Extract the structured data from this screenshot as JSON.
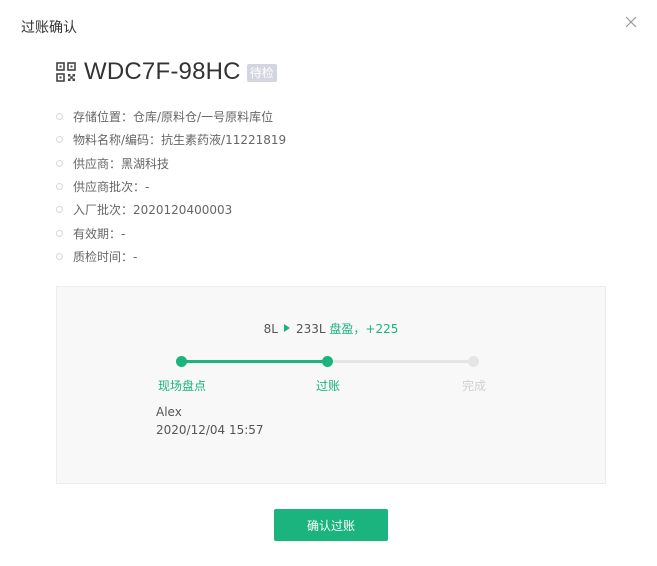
{
  "modal": {
    "title": "过账确认",
    "close_icon": "close-icon"
  },
  "material": {
    "qr_icon": "qr-code-icon",
    "code": "WDC7F-98HC",
    "status": "待检"
  },
  "details": [
    "存储位置：仓库/原料仓/一号原料库位",
    "物料名称/编码：抗生素药液/11221819",
    "供应商：黑湖科技",
    "供应商批次：-",
    "入厂批次：2020120400003",
    "有效期：-",
    "质检时间：-"
  ],
  "summary": {
    "from": "8L",
    "to": "233L",
    "result": "盘盈，+225",
    "colors": {
      "accent": "#1bb37e"
    }
  },
  "steps": [
    {
      "label": "现场盘点",
      "state": "done"
    },
    {
      "label": "过账",
      "state": "done"
    },
    {
      "label": "完成",
      "state": "todo"
    }
  ],
  "operation": {
    "operator": "Alex",
    "time": "2020/12/04 15:57"
  },
  "actions": {
    "confirm_label": "确认过账"
  }
}
